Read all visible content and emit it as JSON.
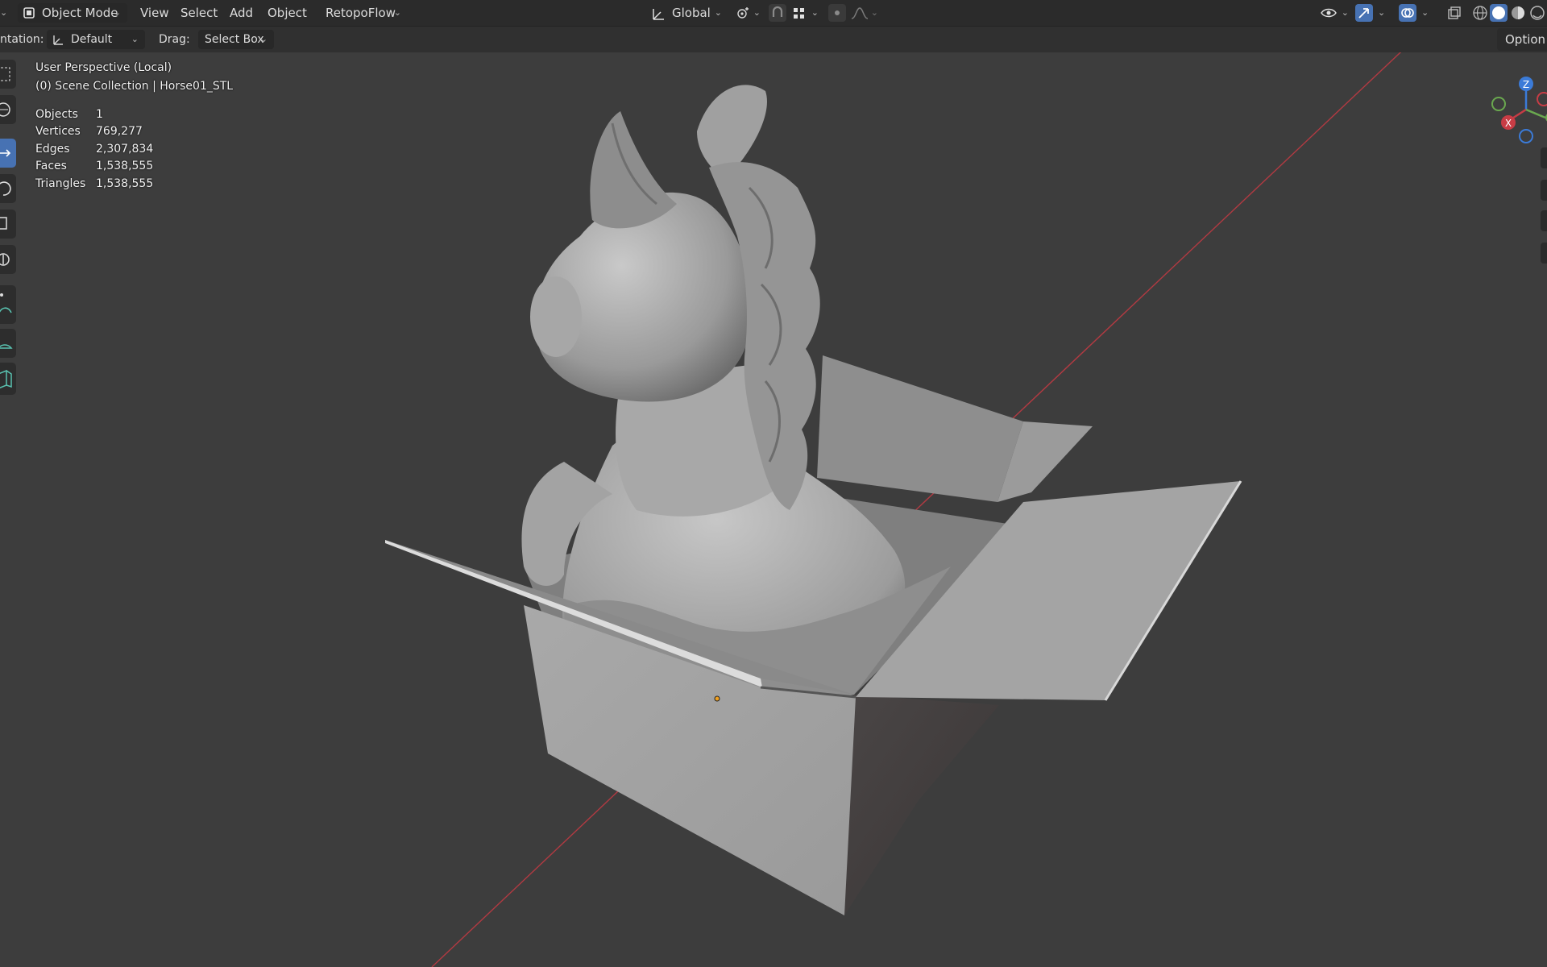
{
  "topbar": {
    "mode_label": "Object Mode",
    "menu": [
      "View",
      "Select",
      "Add",
      "Object"
    ],
    "addon_menu": "RetopoFlow",
    "transform_orientation": "Global"
  },
  "header2": {
    "orientation_label": "ntation:",
    "orientation_value": "Default",
    "drag_label": "Drag:",
    "drag_value": "Select Box",
    "options_label": "Option"
  },
  "overlay": {
    "view_name": "User Perspective (Local)",
    "collection": "(0) Scene Collection | Horse01_STL",
    "stats": [
      {
        "key": "Objects",
        "value": "1"
      },
      {
        "key": "Vertices",
        "value": "769,277"
      },
      {
        "key": "Edges",
        "value": "2,307,834"
      },
      {
        "key": "Faces",
        "value": "1,538,555"
      },
      {
        "key": "Triangles",
        "value": "1,538,555"
      }
    ]
  },
  "gizmo": {
    "z": "Z",
    "x": "X"
  },
  "colors": {
    "accent": "#4772b3",
    "x_axis": "#c83c45",
    "y_axis": "#6aa84f",
    "z_axis": "#3b7bd8",
    "origin": "#f0a020"
  },
  "icons": [
    "editor-type-icon",
    "object-mode-icon",
    "transform-orientation-icon",
    "pivot-icon",
    "snap-icon",
    "snap-target-icon",
    "proportional-icon",
    "falloff-icon",
    "visibility-icon",
    "gizmo-icon",
    "overlay-icon",
    "xray-icon",
    "wireframe-shading-icon",
    "solid-shading-icon",
    "material-shading-icon",
    "rendered-shading-icon",
    "select-box-tool-icon",
    "cursor-tool-icon",
    "move-tool-icon",
    "rotate-tool-icon",
    "scale-tool-icon",
    "transform-tool-icon",
    "annotate-tool-icon",
    "measure-tool-icon",
    "add-cube-tool-icon"
  ]
}
